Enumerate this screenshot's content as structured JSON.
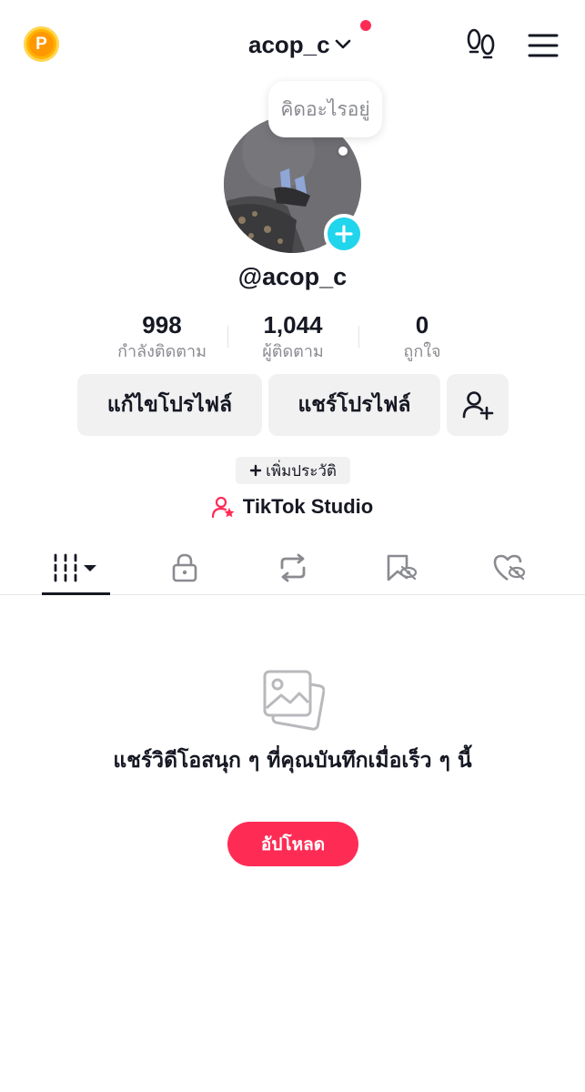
{
  "header": {
    "username": "acop_c",
    "coin_icon": "coin-p-icon",
    "footprint_icon": "footprints-icon",
    "menu_icon": "hamburger-menu-icon",
    "notification_color": "#fe2c55"
  },
  "profile": {
    "thought_placeholder": "คิดอะไรอยู่",
    "handle": "@acop_c",
    "avatar_add_color": "#20d5ec"
  },
  "stats": [
    {
      "value": "998",
      "label": "กำลังติดตาม"
    },
    {
      "value": "1,044",
      "label": "ผู้ติดตาม"
    },
    {
      "value": "0",
      "label": "ถูกใจ"
    }
  ],
  "actions": {
    "edit_profile": "แก้ไขโปรไฟล์",
    "share_profile": "แชร์โปรไฟล์",
    "add_bio": "เพิ่มประวัติ",
    "studio": "TikTok Studio"
  },
  "tabs": [
    {
      "icon": "videos-grid-icon",
      "selected": true
    },
    {
      "icon": "lock-icon",
      "selected": false
    },
    {
      "icon": "repost-icon",
      "selected": false
    },
    {
      "icon": "favorites-hidden-icon",
      "selected": false
    },
    {
      "icon": "liked-hidden-icon",
      "selected": false
    }
  ],
  "empty_state": {
    "message": "แชร์วิดีโอสนุก ๆ ที่คุณบันทึกเมื่อเร็ว ๆ นี้",
    "upload_label": "อัปโหลด",
    "accent_color": "#fe2c55"
  }
}
